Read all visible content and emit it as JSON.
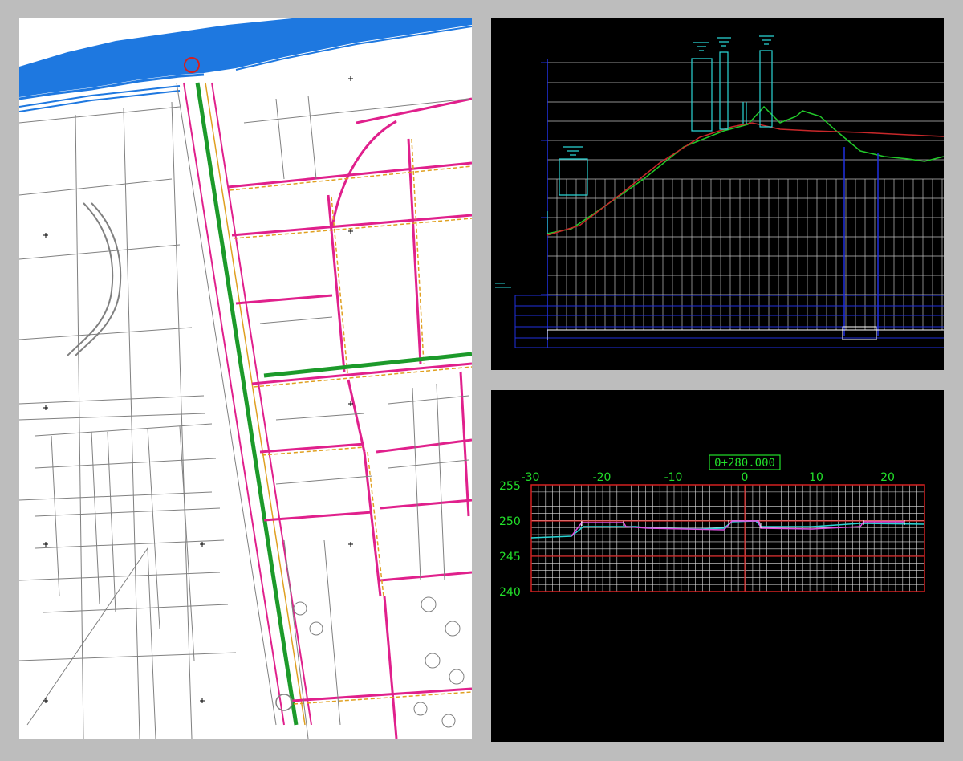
{
  "panels": {
    "plan": {
      "name": "road-plan-view"
    },
    "profile": {
      "name": "longitudinal-profile-view"
    },
    "section": {
      "name": "cross-section-view"
    }
  },
  "cross_section": {
    "station_label": "0+280.000",
    "x_ticks": [
      "-30",
      "-20",
      "-10",
      "0",
      "10",
      "20"
    ],
    "y_ticks": [
      "255",
      "250",
      "245",
      "240"
    ]
  },
  "colors": {
    "background": "#bdbdbd",
    "plan_bg": "#ffffff",
    "cad_bg": "#000000",
    "grid_red": "#d42020",
    "label_green": "#22e02a",
    "water_blue": "#1e78e0",
    "road_magenta": "#e0208c",
    "road_green": "#1c9a2a",
    "profile_cyan": "#2ad6d6",
    "ground_green": "#22c82a",
    "design_red": "#c8282a",
    "frame_blue": "#2030e0"
  }
}
